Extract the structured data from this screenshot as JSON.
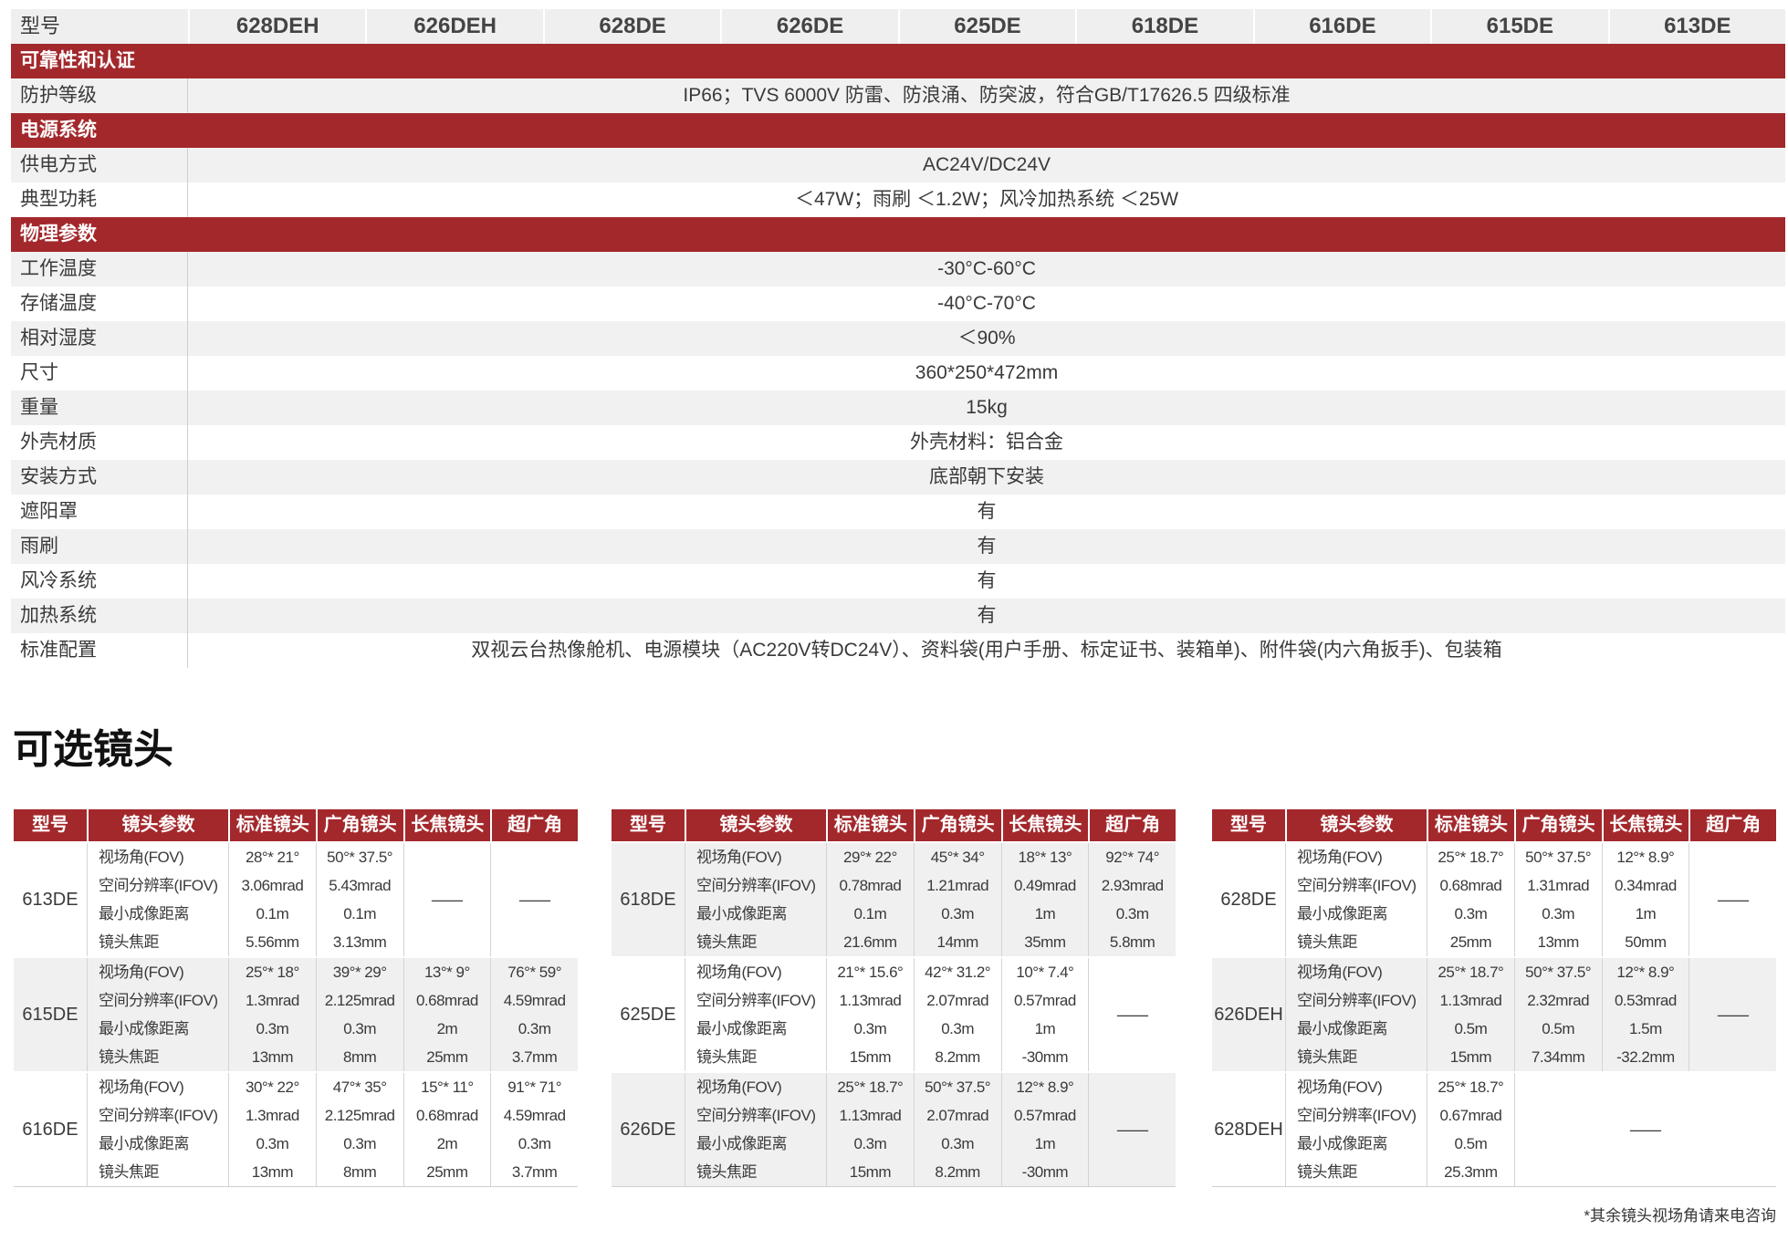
{
  "spec_table": {
    "header_label": "型号",
    "models": [
      "628DEH",
      "626DEH",
      "628DE",
      "626DE",
      "625DE",
      "618DE",
      "616DE",
      "615DE",
      "613DE"
    ],
    "sections": [
      {
        "title": "可靠性和认证",
        "rows": [
          {
            "label": "防护等级",
            "value": "IP66；TVS 6000V 防雷、防浪涌、防突波，符合GB/T17626.5 四级标准"
          }
        ]
      },
      {
        "title": "电源系统",
        "rows": [
          {
            "label": "供电方式",
            "value": "AC24V/DC24V"
          },
          {
            "label": "典型功耗",
            "value": "＜47W；雨刷 ＜1.2W；风冷加热系统 ＜25W"
          }
        ]
      },
      {
        "title": "物理参数",
        "rows": [
          {
            "label": "工作温度",
            "value": "-30°C-60°C"
          },
          {
            "label": "存储温度",
            "value": "-40°C-70°C"
          },
          {
            "label": "相对湿度",
            "value": "＜90%"
          },
          {
            "label": "尺寸",
            "value": "360*250*472mm"
          },
          {
            "label": "重量",
            "value": "15kg"
          },
          {
            "label": "外壳材质",
            "value": "外壳材料：铝合金"
          },
          {
            "label": "安装方式",
            "value": "底部朝下安装"
          },
          {
            "label": "遮阳罩",
            "value": "有"
          },
          {
            "label": "雨刷",
            "value": "有"
          },
          {
            "label": "风冷系统",
            "value": "有"
          },
          {
            "label": "加热系统",
            "value": "有"
          },
          {
            "label": "标准配置",
            "value": "双视云台热像舱机、电源模块（AC220V转DC24V）、资料袋(用户手册、标定证书、装箱单)、附件袋(内六角扳手)、包装箱"
          }
        ]
      }
    ]
  },
  "lens_section": {
    "title": "可选镜头",
    "columns": [
      "型号",
      "镜头参数",
      "标准镜头",
      "广角镜头",
      "长焦镜头",
      "超广角"
    ],
    "param_labels": [
      "视场角(FOV)",
      "空间分辨率(IFOV)",
      "最小成像距离",
      "镜头焦距"
    ],
    "tables": [
      {
        "groups": [
          {
            "model": "613DE",
            "lenses": [
              [
                "28°* 21°",
                "3.06mrad",
                "0.1m",
                "5.56mm"
              ],
              [
                "50°* 37.5°",
                "5.43mrad",
                "0.1m",
                "3.13mm"
              ],
              "—",
              "—"
            ]
          },
          {
            "model": "615DE",
            "lenses": [
              [
                "25°* 18°",
                "1.3mrad",
                "0.3m",
                "13mm"
              ],
              [
                "39°* 29°",
                "2.125mrad",
                "0.3m",
                "8mm"
              ],
              [
                "13°* 9°",
                "0.68mrad",
                "2m",
                "25mm"
              ],
              [
                "76°* 59°",
                "4.59mrad",
                "0.3m",
                "3.7mm"
              ]
            ]
          },
          {
            "model": "616DE",
            "lenses": [
              [
                "30°* 22°",
                "1.3mrad",
                "0.3m",
                "13mm"
              ],
              [
                "47°* 35°",
                "2.125mrad",
                "0.3m",
                "8mm"
              ],
              [
                "15°* 11°",
                "0.68mrad",
                "2m",
                "25mm"
              ],
              [
                "91°* 71°",
                "4.59mrad",
                "0.3m",
                "3.7mm"
              ]
            ]
          }
        ]
      },
      {
        "groups": [
          {
            "model": "618DE",
            "lenses": [
              [
                "29°* 22°",
                "0.78mrad",
                "0.1m",
                "21.6mm"
              ],
              [
                "45°* 34°",
                "1.21mrad",
                "0.3m",
                "14mm"
              ],
              [
                "18°* 13°",
                "0.49mrad",
                "1m",
                "35mm"
              ],
              [
                "92°* 74°",
                "2.93mrad",
                "0.3m",
                "5.8mm"
              ]
            ]
          },
          {
            "model": "625DE",
            "lenses": [
              [
                "21°* 15.6°",
                "1.13mrad",
                "0.3m",
                "15mm"
              ],
              [
                "42°* 31.2°",
                "2.07mrad",
                "0.3m",
                "8.2mm"
              ],
              [
                "10°* 7.4°",
                "0.57mrad",
                "1m",
                "-30mm"
              ],
              "—"
            ]
          },
          {
            "model": "626DE",
            "lenses": [
              [
                "25°* 18.7°",
                "1.13mrad",
                "0.3m",
                "15mm"
              ],
              [
                "50°* 37.5°",
                "2.07mrad",
                "0.3m",
                "8.2mm"
              ],
              [
                "12°* 8.9°",
                "0.57mrad",
                "1m",
                "-30mm"
              ],
              "—"
            ]
          }
        ]
      },
      {
        "groups": [
          {
            "model": "628DE",
            "lenses": [
              [
                "25°* 18.7°",
                "0.68mrad",
                "0.3m",
                "25mm"
              ],
              [
                "50°* 37.5°",
                "1.31mrad",
                "0.3m",
                "13mm"
              ],
              [
                "12°* 8.9°",
                "0.34mrad",
                "1m",
                "50mm"
              ],
              "—"
            ]
          },
          {
            "model": "626DEH",
            "lenses": [
              [
                "25°* 18.7°",
                "1.13mrad",
                "0.5m",
                "15mm"
              ],
              [
                "50°* 37.5°",
                "2.32mrad",
                "0.5m",
                "7.34mm"
              ],
              [
                "12°* 8.9°",
                "0.53mrad",
                "1.5m",
                "-32.2mm"
              ],
              "—"
            ]
          },
          {
            "model": "628DEH",
            "lenses": [
              [
                "25°* 18.7°",
                "0.67mrad",
                "0.5m",
                "25.3mm"
              ],
              "—"
            ]
          }
        ]
      }
    ],
    "footnote": "*其余镜头视场角请来电咨询"
  }
}
